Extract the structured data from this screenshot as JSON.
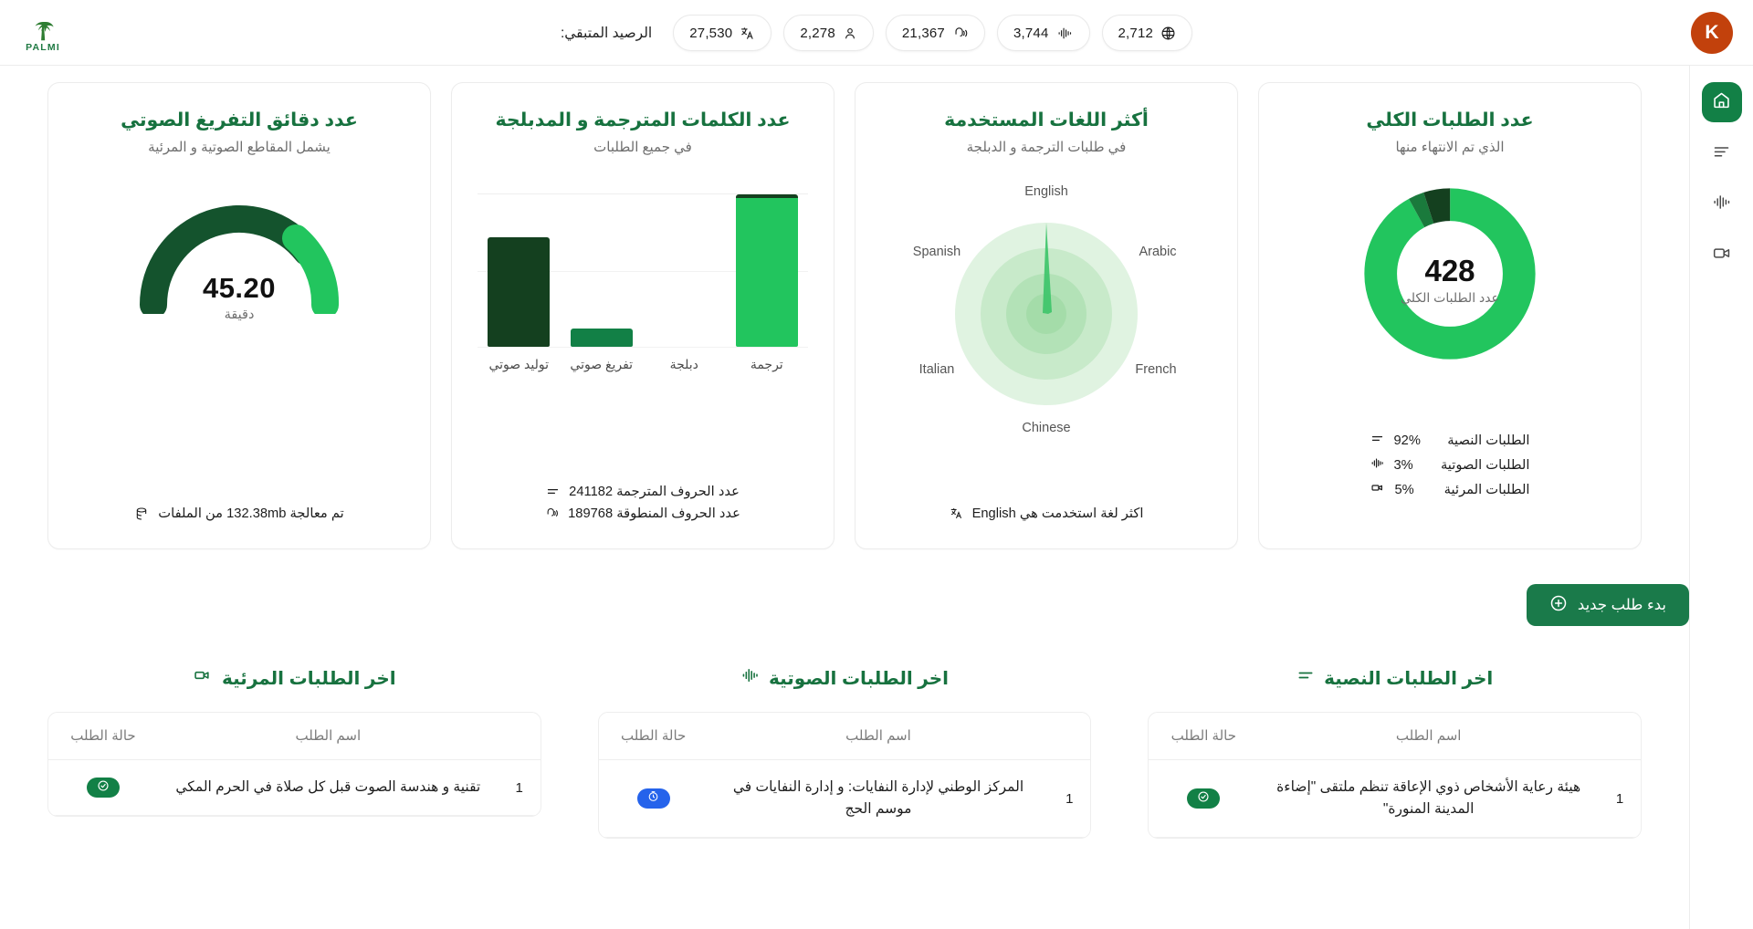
{
  "brand": {
    "wordmark": "PALMI",
    "logo_icon": "palm-tree-icon"
  },
  "header": {
    "balance_label": "الرصيد المتبقي:",
    "avatar_initial": "K",
    "chips": [
      {
        "value": "2,712",
        "icon": "globe-translate-icon"
      },
      {
        "value": "3,744",
        "icon": "audio-waveform-icon"
      },
      {
        "value": "21,367",
        "icon": "headphone-sound-icon"
      },
      {
        "value": "2,278",
        "icon": "user-icon"
      },
      {
        "value": "27,530",
        "icon": "language-translate-icon"
      }
    ]
  },
  "rail": {
    "items": [
      {
        "name": "home",
        "icon": "home-icon",
        "active": true
      },
      {
        "name": "text-orders",
        "icon": "text-lines-icon",
        "active": false
      },
      {
        "name": "audio-orders",
        "icon": "audio-waveform-icon",
        "active": false
      },
      {
        "name": "video-orders",
        "icon": "video-camera-icon",
        "active": false
      }
    ]
  },
  "cards": {
    "gauge": {
      "title": "عدد دقائق التفريغ الصوتي",
      "subtitle": "يشمل المقاطع الصوتية و المرئية",
      "value": "45.20",
      "unit": "دقيقة",
      "footer": {
        "icon": "database-icon",
        "text": "تم معالجة 132.38mb من الملفات"
      }
    },
    "bars": {
      "title": "عدد الكلمات المترجمة و المدبلجة",
      "subtitle": "في جميع الطلبات",
      "footer_lines": [
        {
          "icon": "text-lines-icon",
          "text": "عدد الحروف المترجمة 241182"
        },
        {
          "icon": "headphone-sound-icon",
          "text": "عدد الحروف المنطوقة 189768"
        }
      ]
    },
    "radar": {
      "title": "أكثر اللغات المستخدمة",
      "subtitle": "في طلبات الترجمة و الدبلجة",
      "footer": {
        "icon": "language-translate-icon",
        "text": "اكثر لغة استخدمت هي English"
      }
    },
    "donut": {
      "title": "عدد الطلبات الكلي",
      "subtitle": "الذي تم الانتهاء منها",
      "center_value": "428",
      "center_caption": "عدد الطلبات الكلي",
      "legend": [
        {
          "label": "الطلبات النصية",
          "percent": "92%",
          "icon": "text-lines-icon",
          "color": "#22c55e"
        },
        {
          "label": "الطلبات الصوتية",
          "percent": "3%",
          "icon": "audio-waveform-icon",
          "color": "#1a7a3c"
        },
        {
          "label": "الطلبات المرئية",
          "percent": "5%",
          "icon": "video-camera-icon",
          "color": "#14401f"
        }
      ]
    }
  },
  "cta": {
    "label": "بدء طلب جديد",
    "icon": "plus-circle-icon"
  },
  "panels": [
    {
      "title": "اخر الطلبات النصية",
      "icon": "text-lines-icon",
      "columns": {
        "name": "اسم الطلب",
        "state": "حالة الطلب"
      },
      "rows": [
        {
          "index": "1",
          "name": "هيئة رعاية الأشخاص ذوي الإعاقة تنظم ملتقى \"إضاءة المدينة المنورة\"",
          "status": "done",
          "status_icon": "check-circle-icon"
        }
      ]
    },
    {
      "title": "اخر الطلبات الصوتية",
      "icon": "audio-waveform-icon",
      "columns": {
        "name": "اسم الطلب",
        "state": "حالة الطلب"
      },
      "rows": [
        {
          "index": "1",
          "name": "المركز الوطني لإدارة النفايات: و إدارة النفايات في موسم الحج",
          "status": "pending",
          "status_icon": "timer-icon"
        }
      ]
    },
    {
      "title": "اخر الطلبات المرئية",
      "icon": "video-camera-icon",
      "columns": {
        "name": "اسم الطلب",
        "state": "حالة الطلب"
      },
      "rows": [
        {
          "index": "1",
          "name": "تقنية و هندسة الصوت قبل كل صلاة في الحرم المكي",
          "status": "done",
          "status_icon": "check-circle-icon"
        }
      ]
    }
  ],
  "chart_data": [
    {
      "type": "bar",
      "title": "عدد الكلمات المترجمة و المدبلجة",
      "subtitle": "في جميع الطلبات",
      "categories": [
        "ترجمة",
        "دبلجة",
        "تفريغ صوتي",
        "توليد صوتي"
      ],
      "values": [
        100,
        0,
        12,
        72
      ],
      "colors": [
        "#22c55e",
        "#22c55e",
        "#128046",
        "#14401f"
      ],
      "ylabel": "",
      "xlabel": "",
      "ylim": [
        0,
        105
      ],
      "grid": true
    },
    {
      "type": "pie",
      "title": "عدد الطلبات الكلي",
      "subtitle": "الذي تم الانتهاء منها",
      "labels": [
        "الطلبات النصية",
        "الطلبات الصوتية",
        "الطلبات المرئية"
      ],
      "values": [
        92,
        3,
        5
      ],
      "colors": [
        "#22c55e",
        "#1a7a3c",
        "#14401f"
      ],
      "center_value": "428",
      "legend": "bottom"
    },
    {
      "type": "radar",
      "title": "أكثر اللغات المستخدمة",
      "subtitle": "في طلبات الترجمة و الدبلجة",
      "categories": [
        "English",
        "Arabic",
        "French",
        "Chinese",
        "Italian",
        "Spanish"
      ],
      "values": [
        100,
        2,
        1,
        1,
        1,
        2
      ],
      "ylim": [
        0,
        100
      ],
      "grid": true
    },
    {
      "type": "gauge",
      "title": "عدد دقائق التفريغ الصوتي",
      "subtitle": "يشمل المقاطع الصوتية و المرئية",
      "value": 45.2,
      "unit": "دقيقة",
      "segments": [
        {
          "name": "dark",
          "fraction": 0.67,
          "color": "#14532d"
        },
        {
          "name": "light",
          "fraction": 0.33,
          "color": "#22c55e"
        }
      ]
    }
  ]
}
